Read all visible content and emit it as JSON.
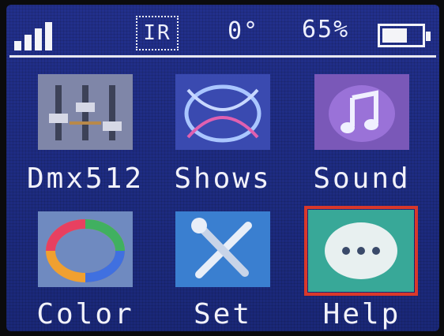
{
  "status": {
    "ir_label": "IR",
    "angle": "0°",
    "battery_percent_text": "65%",
    "battery_level": 0.65
  },
  "menu": [
    {
      "label": "Dmx512",
      "icon": "faders-icon"
    },
    {
      "label": "Shows",
      "icon": "shows-icon"
    },
    {
      "label": "Sound",
      "icon": "music-note-icon"
    },
    {
      "label": "Color",
      "icon": "color-ring-icon"
    },
    {
      "label": "Set",
      "icon": "tools-icon"
    },
    {
      "label": "Help",
      "icon": "help-bubble-icon"
    }
  ],
  "selected_item": "Help",
  "colors": {
    "screen_bg": "#1c2a7c",
    "selection": "#d8382b",
    "text": "#eef0ff"
  }
}
